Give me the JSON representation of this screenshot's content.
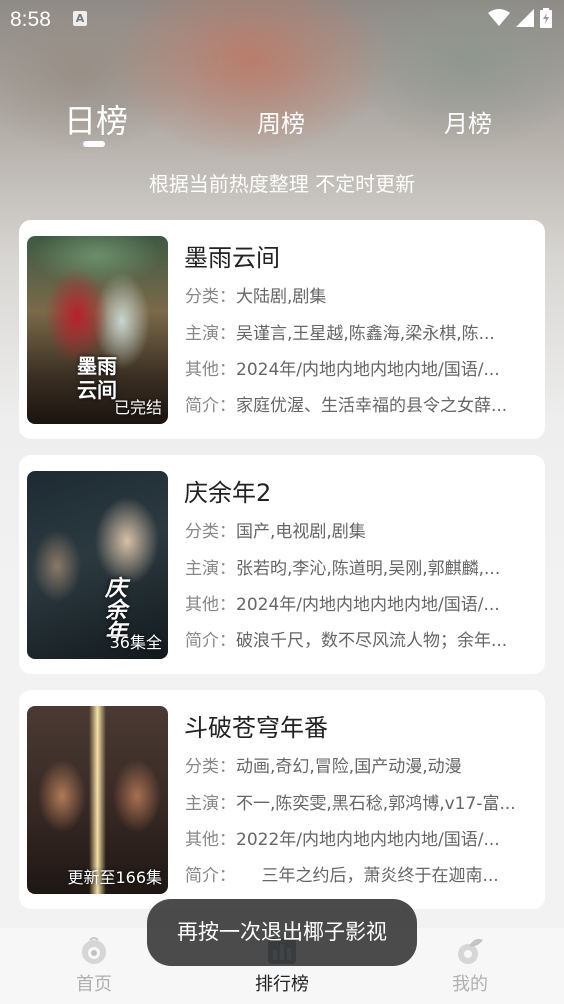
{
  "status_bar": {
    "time": "8:58",
    "notification_letter": "A"
  },
  "tabs": [
    {
      "label": "日榜",
      "active": true
    },
    {
      "label": "周榜",
      "active": false
    },
    {
      "label": "月榜",
      "active": false
    }
  ],
  "subtitle": "根据当前热度整理 不定时更新",
  "labels": {
    "category": "分类：",
    "cast": "主演：",
    "other": "其他：",
    "intro": "简介："
  },
  "items": [
    {
      "title": "墨雨云间",
      "category": "大陆剧,剧集",
      "cast": "吴谨言,王星越,陈鑫海,梁永棋,陈...",
      "other": "2024年/内地内地内地内地/国语/...",
      "intro": "家庭优渥、生活幸福的县令之女薛...",
      "badge": "已完结",
      "poster_text": "墨雨\n云间"
    },
    {
      "title": "庆余年2",
      "category": "国产,电视剧,剧集",
      "cast": "张若昀,李沁,陈道明,吴刚,郭麒麟,...",
      "other": "2024年/内地内地内地内地/国语/...",
      "intro": "破浪千尺，数不尽风流人物；余年...",
      "badge": "36集全",
      "poster_text": "庆余年"
    },
    {
      "title": "斗破苍穹年番",
      "category": "动画,奇幻,冒险,国产动漫,动漫",
      "cast": "不一,陈奕雯,黑石稔,郭鸿博,v17-富...",
      "other": "2022年/内地内地内地内地/国语/...",
      "intro": "　　三年之约后，萧炎终于在迦南...",
      "badge": "更新至166集",
      "poster_text": ""
    }
  ],
  "bottom_nav": [
    {
      "label": "首页",
      "icon": "home-icon",
      "active": false
    },
    {
      "label": "排行榜",
      "icon": "ranking-icon",
      "active": true
    },
    {
      "label": "我的",
      "icon": "profile-icon",
      "active": false
    }
  ],
  "toast": "再按一次退出椰子影视",
  "colors": {
    "accent_text": "#222222",
    "inactive_nav": "#b0b0b0",
    "toast_bg": "#3c3c3c"
  }
}
